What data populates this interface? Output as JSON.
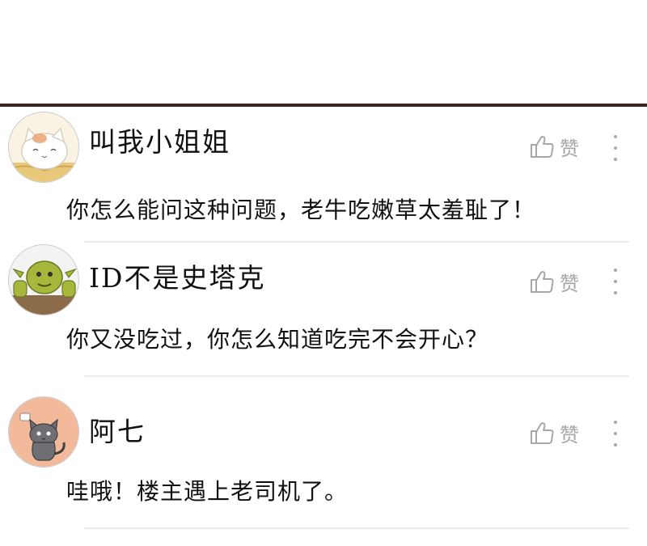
{
  "comments": [
    {
      "username": "叫我小姐姐",
      "text": "你怎么能问这种问题，老牛吃嫩草太羞耻了！",
      "like_label": "赞",
      "avatar_icon": "cat-avatar-icon"
    },
    {
      "username": "ID不是史塔克",
      "text": "你又没吃过，你怎么知道吃完不会开心？",
      "like_label": "赞",
      "avatar_icon": "ogre-avatar-icon"
    },
    {
      "username": "阿七",
      "text": "哇哦！楼主遇上老司机了。",
      "like_label": "赞",
      "avatar_icon": "gray-cat-avatar-icon"
    }
  ],
  "colors": {
    "top_divider": "#3a2620",
    "separator": "#ececec",
    "muted": "#a7a7a7",
    "text": "#111111"
  }
}
